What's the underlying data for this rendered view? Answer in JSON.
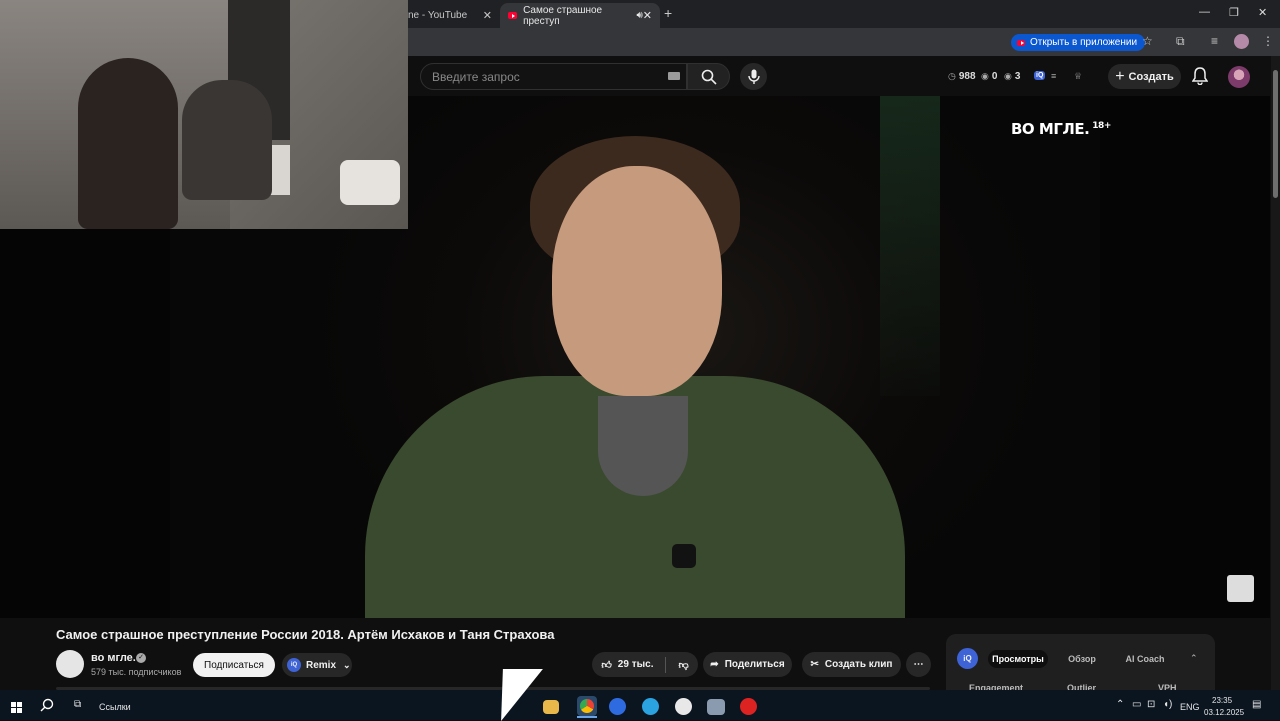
{
  "browser": {
    "tabs": [
      {
        "label": "ne - YouTube"
      },
      {
        "label": "Самое страшное преступ"
      }
    ],
    "open_in_app": "Открыть в приложении"
  },
  "masthead": {
    "search_placeholder": "Введите запрос",
    "stats": {
      "views": "988",
      "likes": "0",
      "comments": "3"
    },
    "create_label": "Создать"
  },
  "video": {
    "watermark": "ВО МГЛЕ.",
    "age_rating": "18+",
    "title": "Самое страшное преступление России 2018. Артём Исхаков и Таня Страхова"
  },
  "channel": {
    "name": "во мгле.",
    "verified_mark": "✓",
    "subscribers": "579 тыс. подписчиков",
    "subscribe_label": "Подписаться",
    "remix_label": "Remix",
    "iq_label": "iQ"
  },
  "actions": {
    "likes": "29 тыс.",
    "share": "Поделиться",
    "clip": "Создать клип"
  },
  "vidiq": {
    "logo": "iQ",
    "tabs": [
      "Просмотры",
      "Обзор",
      "AI Coach"
    ],
    "selected_tab": 0,
    "columns": [
      "Engagement",
      "Outlier",
      "VPH"
    ]
  },
  "taskbar": {
    "links_label": "Ссылки",
    "lang": "ENG",
    "time": "23:35",
    "date": "03.12.2025"
  },
  "colors": {
    "youtube_red": "#ff0033",
    "chrome_blue": "#0b57d0",
    "vidiq_blue": "#3e63d6"
  }
}
